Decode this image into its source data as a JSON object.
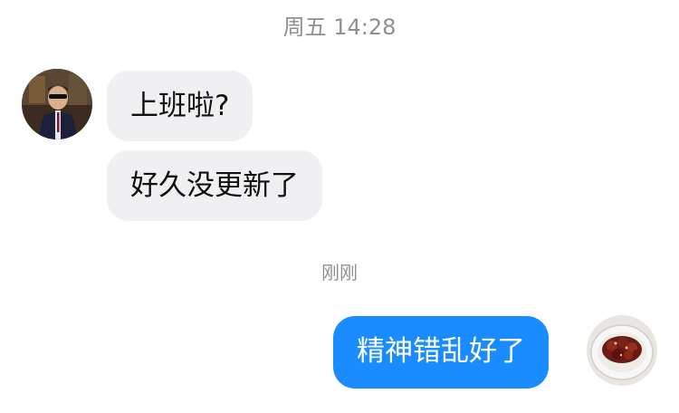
{
  "timestamps": {
    "first": "周五 14:28",
    "second": "刚刚"
  },
  "messages": {
    "incoming": [
      {
        "text": "上班啦?"
      },
      {
        "text": "好久没更新了"
      }
    ],
    "outgoing": [
      {
        "text": "精神错乱好了"
      }
    ]
  },
  "colors": {
    "incoming_bubble": "#f0f0f3",
    "outgoing_bubble": "#1a8cff",
    "timestamp_text": "#8e8e93"
  }
}
